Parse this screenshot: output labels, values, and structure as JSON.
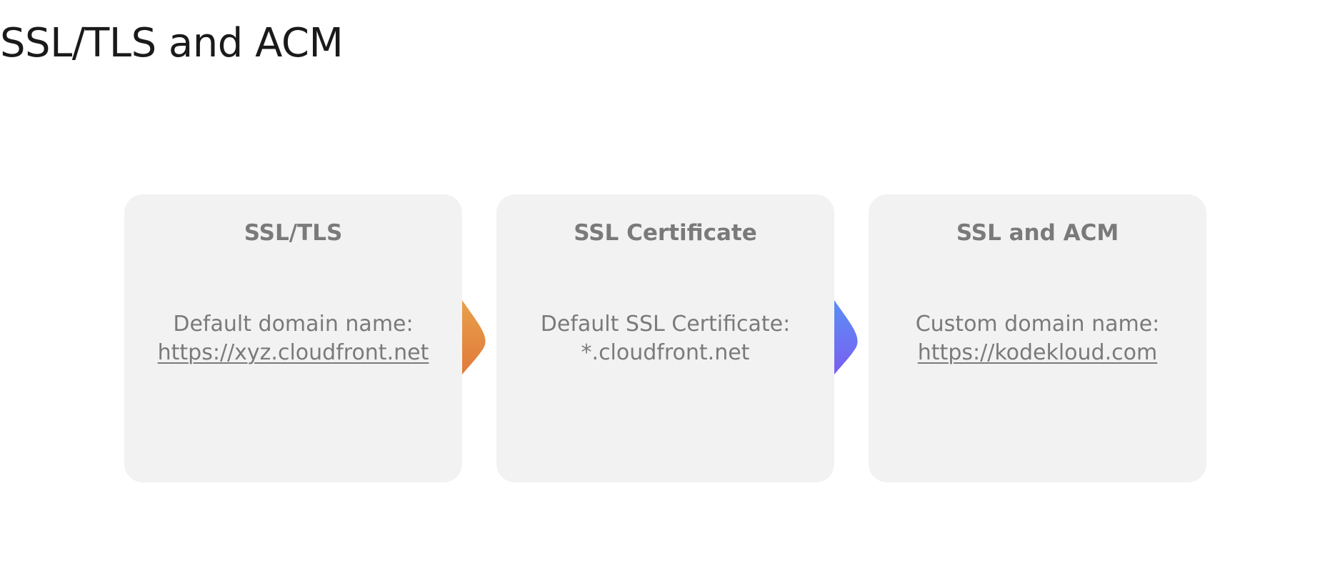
{
  "title": "SSL/TLS and ACM",
  "cards": [
    {
      "heading": "SSL/TLS",
      "line1": "Default domain name:",
      "line2": "https://xyz.cloudfront.net"
    },
    {
      "heading": "SSL Certificate",
      "line1": "Default SSL Certificate:",
      "line2": "*.cloudfront.net"
    },
    {
      "heading": "SSL and ACM",
      "line1": "Custom domain name:",
      "line2": "https://kodekloud.com"
    }
  ],
  "colors": {
    "card_background": "#f2f2f2",
    "card_text": "#7a7a7a",
    "connector_1_start": "#e8a04a",
    "connector_1_end": "#e07a3a",
    "connector_2_start": "#5a8ff5",
    "connector_2_end": "#7a5ef0"
  }
}
